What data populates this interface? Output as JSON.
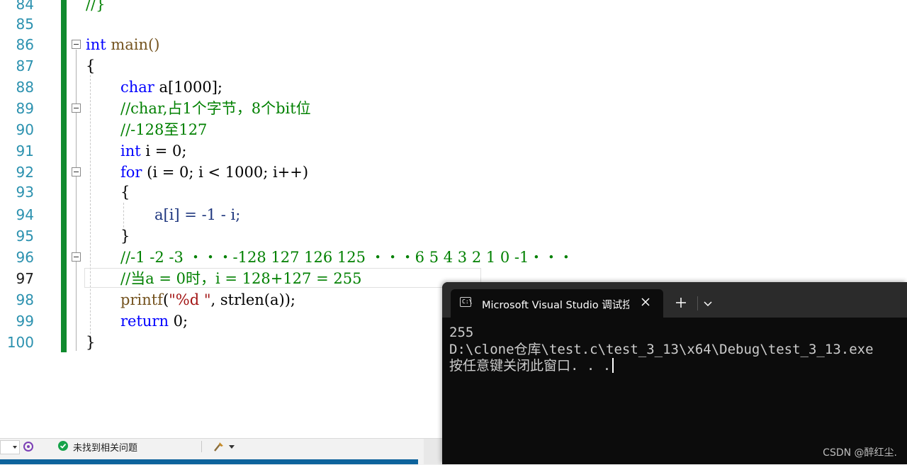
{
  "editor": {
    "active_line": "97",
    "lines": [
      {
        "num": "84",
        "code": "//}"
      },
      {
        "num": "85",
        "code": ""
      },
      {
        "num": "86",
        "kw": "int",
        "rest": " main()"
      },
      {
        "num": "87",
        "code": "{"
      },
      {
        "num": "88",
        "kw": "char",
        "rest": " a[1000];"
      },
      {
        "num": "89",
        "comment": "//char,占1个字节，8个bit位"
      },
      {
        "num": "90",
        "comment": "//-128至127"
      },
      {
        "num": "91",
        "kw": "int",
        "rest": " i = 0;"
      },
      {
        "num": "92",
        "kw": "for",
        "rest": " (i = 0; i < 1000; i++)"
      },
      {
        "num": "93",
        "code": "{"
      },
      {
        "num": "94",
        "code": "a[i] = -1 - i;"
      },
      {
        "num": "95",
        "code": "}"
      },
      {
        "num": "96",
        "comment": "//-1 -2 -3 ・・・-128 127 126 125 ・・・6 5 4 3 2 1 0 -1・・・"
      },
      {
        "num": "97",
        "comment": "//当a = 0时，i = 128+127 = 255"
      },
      {
        "num": "98",
        "fn": "printf",
        "open": "(",
        "str": "\"%d \"",
        "rest": ", strlen(a));"
      },
      {
        "num": "99",
        "kw": "return",
        "rest": " 0;"
      },
      {
        "num": "100",
        "code": "}"
      }
    ]
  },
  "status": {
    "issues_text": "未找到相关问题"
  },
  "console": {
    "tab_title": "Microsoft Visual Studio 调试控制台",
    "output": [
      "255",
      "D:\\clone仓库\\test.c\\test_3_13\\x64\\Debug\\test_3_13.exe",
      "按任意键关闭此窗口. . ."
    ]
  },
  "watermark": "CSDN @醉红尘."
}
